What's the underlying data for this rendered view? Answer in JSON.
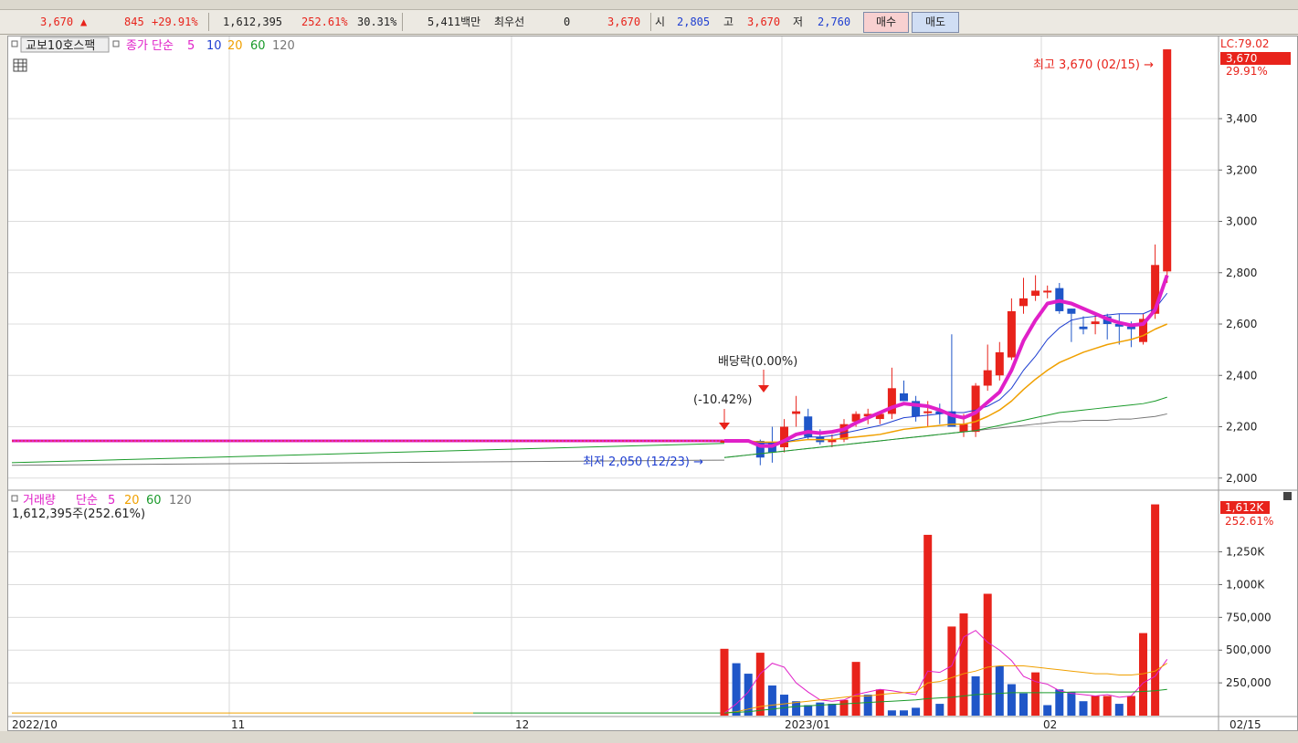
{
  "infobar": {
    "price": "3,670",
    "up_arrow": "▲",
    "change": "845",
    "change_pct": "+29.91%",
    "volume": "1,612,395",
    "volume_ratio": "252.61%",
    "turnover": "30.31%",
    "amount": "5,411백만",
    "best_bid_label": "최우선",
    "best_bid_value": "0",
    "last": "3,670",
    "open_label": "시",
    "open_value": "2,805",
    "high_label": "고",
    "high_value": "3,670",
    "low_label": "저",
    "low_value": "2,760",
    "buy_label": "매수",
    "sell_label": "매도"
  },
  "price_panel": {
    "legend_name": "교보10호스팩",
    "legend_ma": "종가 단순",
    "ma_periods": [
      "5",
      "10",
      "20",
      "60",
      "120"
    ],
    "axis_ticks": [
      "3,400",
      "3,200",
      "3,000",
      "2,800",
      "2,600",
      "2,400",
      "2,200",
      "2,000"
    ],
    "lc_label": "LC:79.02",
    "current_tag": "3,670",
    "current_pct": "29.91%",
    "high_annotation": "최고 3,670 (02/15) →",
    "low_annotation": "최저 2,050 (12/23) →",
    "dividend_label": "배당락(0.00%)",
    "pct_label": "(-10.42%)"
  },
  "volume_panel": {
    "legend_name": "거래량",
    "legend_ma": "단순",
    "ma_periods": [
      "5",
      "20",
      "60",
      "120"
    ],
    "sub_label": "1,612,395주(252.61%)",
    "axis_ticks": [
      "1,250K",
      "1,000K",
      "750,000",
      "500,000",
      "250,000"
    ],
    "current_tag": "1,612K",
    "current_pct": "252.61%"
  },
  "x_axis": {
    "labels": [
      "2022/10",
      "11",
      "12",
      "2023/01",
      "02"
    ],
    "right_label": "02/15"
  },
  "colors": {
    "up": "#e8231b",
    "down": "#1f56c8",
    "ma5": "#e020c8",
    "ma10": "#1f3fd1",
    "ma20": "#f0a000",
    "ma60": "#1a9a2a",
    "ma120": "#777777"
  },
  "chart_data": [
    {
      "type": "candlestick",
      "title": "교보10호스팩",
      "ylim": [
        1960,
        3720
      ],
      "flat_level_before_12_20": 2145,
      "dates": [
        "12/20",
        "12/21",
        "12/22",
        "12/23",
        "12/26",
        "12/27",
        "12/28",
        "12/29",
        "01/02",
        "01/03",
        "01/04",
        "01/05",
        "01/06",
        "01/09",
        "01/10",
        "01/11",
        "01/12",
        "01/13",
        "01/16",
        "01/17",
        "01/18",
        "01/19",
        "01/20",
        "01/25",
        "01/26",
        "01/27",
        "01/30",
        "01/31",
        "02/01",
        "02/02",
        "02/03",
        "02/06",
        "02/07",
        "02/08",
        "02/09",
        "02/10",
        "02/13",
        "02/14",
        "02/15"
      ],
      "ohlc": [
        [
          2145,
          2145,
          2145,
          2145
        ],
        [
          2145,
          2145,
          2145,
          2145
        ],
        [
          2145,
          2145,
          2145,
          2145
        ],
        [
          2145,
          2150,
          2050,
          2080
        ],
        [
          2140,
          2200,
          2060,
          2100
        ],
        [
          2120,
          2230,
          2100,
          2200
        ],
        [
          2250,
          2320,
          2200,
          2260
        ],
        [
          2240,
          2270,
          2150,
          2160
        ],
        [
          2160,
          2190,
          2130,
          2140
        ],
        [
          2140,
          2170,
          2120,
          2150
        ],
        [
          2150,
          2230,
          2140,
          2210
        ],
        [
          2220,
          2260,
          2200,
          2250
        ],
        [
          2240,
          2270,
          2210,
          2250
        ],
        [
          2230,
          2260,
          2210,
          2250
        ],
        [
          2250,
          2430,
          2230,
          2350
        ],
        [
          2330,
          2380,
          2300,
          2300
        ],
        [
          2300,
          2320,
          2220,
          2240
        ],
        [
          2260,
          2300,
          2200,
          2260
        ],
        [
          2260,
          2290,
          2210,
          2250
        ],
        [
          2260,
          2560,
          2220,
          2200
        ],
        [
          2180,
          2250,
          2160,
          2210
        ],
        [
          2180,
          2370,
          2160,
          2360
        ],
        [
          2360,
          2520,
          2340,
          2420
        ],
        [
          2400,
          2530,
          2380,
          2490
        ],
        [
          2470,
          2700,
          2460,
          2650
        ],
        [
          2670,
          2780,
          2640,
          2700
        ],
        [
          2710,
          2790,
          2690,
          2730
        ],
        [
          2730,
          2750,
          2700,
          2730
        ],
        [
          2740,
          2760,
          2640,
          2650
        ],
        [
          2660,
          2660,
          2530,
          2640
        ],
        [
          2590,
          2630,
          2560,
          2580
        ],
        [
          2600,
          2640,
          2560,
          2610
        ],
        [
          2630,
          2640,
          2540,
          2600
        ],
        [
          2600,
          2640,
          2520,
          2590
        ],
        [
          2590,
          2610,
          2510,
          2580
        ],
        [
          2530,
          2640,
          2520,
          2620
        ],
        [
          2640,
          2910,
          2620,
          2830
        ],
        [
          2805,
          3670,
          2760,
          3670
        ]
      ],
      "series": [
        {
          "name": "5",
          "values": [
            2145,
            2145,
            2145,
            2125,
            2125,
            2145,
            2170,
            2180,
            2175,
            2180,
            2190,
            2215,
            2235,
            2255,
            2275,
            2290,
            2285,
            2280,
            2265,
            2245,
            2235,
            2255,
            2295,
            2335,
            2420,
            2535,
            2615,
            2680,
            2690,
            2680,
            2660,
            2640,
            2620,
            2605,
            2595,
            2600,
            2655,
            2790
          ]
        },
        {
          "name": "10",
          "values": [
            2145,
            2145,
            2145,
            2135,
            2135,
            2140,
            2150,
            2160,
            2160,
            2165,
            2175,
            2185,
            2195,
            2205,
            2220,
            2235,
            2240,
            2245,
            2250,
            2255,
            2255,
            2265,
            2280,
            2305,
            2350,
            2420,
            2475,
            2540,
            2585,
            2615,
            2625,
            2630,
            2635,
            2640,
            2640,
            2640,
            2660,
            2720
          ]
        },
        {
          "name": "20",
          "values": [
            2145,
            2145,
            2145,
            2140,
            2140,
            2140,
            2145,
            2150,
            2150,
            2150,
            2155,
            2160,
            2165,
            2170,
            2180,
            2190,
            2195,
            2200,
            2205,
            2210,
            2210,
            2220,
            2240,
            2265,
            2300,
            2345,
            2385,
            2420,
            2450,
            2470,
            2490,
            2505,
            2520,
            2530,
            2540,
            2555,
            2580,
            2600
          ]
        },
        {
          "name": "60",
          "values": [
            2080,
            2085,
            2090,
            2095,
            2100,
            2105,
            2110,
            2115,
            2120,
            2125,
            2130,
            2135,
            2140,
            2145,
            2150,
            2155,
            2160,
            2165,
            2170,
            2175,
            2180,
            2185,
            2195,
            2205,
            2215,
            2225,
            2235,
            2245,
            2255,
            2260,
            2265,
            2270,
            2275,
            2280,
            2285,
            2290,
            2300,
            2315
          ]
        },
        {
          "name": "120",
          "values": [
            2080,
            2085,
            2090,
            2095,
            2100,
            2105,
            2110,
            2115,
            2120,
            2125,
            2130,
            2135,
            2140,
            2145,
            2150,
            2155,
            2160,
            2165,
            2170,
            2175,
            2180,
            2185,
            2190,
            2195,
            2200,
            2205,
            2210,
            2215,
            2220,
            2220,
            2225,
            2225,
            2225,
            2230,
            2230,
            2235,
            2240,
            2250
          ]
        }
      ],
      "ma120_start": [
        2050,
        2070
      ],
      "ma60_start": [
        2060,
        2135
      ]
    },
    {
      "type": "bar",
      "title": "거래량",
      "ylim": [
        0,
        1700000
      ],
      "values": [
        510000,
        400000,
        320000,
        480000,
        230000,
        160000,
        110000,
        80000,
        100000,
        90000,
        120000,
        410000,
        160000,
        200000,
        40000,
        40000,
        60000,
        1380000,
        90000,
        680000,
        780000,
        300000,
        930000,
        380000,
        240000,
        170000,
        330000,
        80000,
        200000,
        180000,
        110000,
        150000,
        150000,
        90000,
        150000,
        630000,
        1612395,
        0
      ],
      "up_flags": [
        1,
        0,
        0,
        1,
        0,
        0,
        0,
        0,
        0,
        0,
        1,
        1,
        0,
        1,
        0,
        0,
        0,
        1,
        0,
        1,
        1,
        0,
        1,
        0,
        0,
        0,
        1,
        0,
        0,
        0,
        0,
        1,
        1,
        0,
        1,
        1,
        1,
        1
      ],
      "series": [
        {
          "name": "5",
          "values": [
            20000,
            90000,
            180000,
            320000,
            400000,
            370000,
            250000,
            180000,
            120000,
            110000,
            120000,
            160000,
            180000,
            200000,
            190000,
            175000,
            160000,
            340000,
            330000,
            380000,
            600000,
            650000,
            560000,
            500000,
            420000,
            300000,
            260000,
            240000,
            190000,
            170000,
            160000,
            150000,
            160000,
            140000,
            150000,
            250000,
            300000,
            430000
          ]
        },
        {
          "name": "20",
          "values": [
            20000,
            30000,
            50000,
            70000,
            80000,
            90000,
            100000,
            110000,
            120000,
            130000,
            140000,
            150000,
            150000,
            160000,
            170000,
            175000,
            180000,
            250000,
            260000,
            290000,
            320000,
            340000,
            370000,
            380000,
            380000,
            380000,
            370000,
            360000,
            350000,
            340000,
            330000,
            320000,
            320000,
            310000,
            310000,
            320000,
            340000,
            400000
          ]
        },
        {
          "name": "60",
          "values": [
            20000,
            25000,
            30000,
            40000,
            50000,
            60000,
            70000,
            75000,
            80000,
            85000,
            90000,
            95000,
            100000,
            105000,
            110000,
            115000,
            120000,
            130000,
            135000,
            140000,
            150000,
            160000,
            165000,
            170000,
            175000,
            175000,
            175000,
            175000,
            175000,
            180000,
            180000,
            180000,
            180000,
            180000,
            180000,
            185000,
            190000,
            200000
          ]
        }
      ]
    }
  ]
}
